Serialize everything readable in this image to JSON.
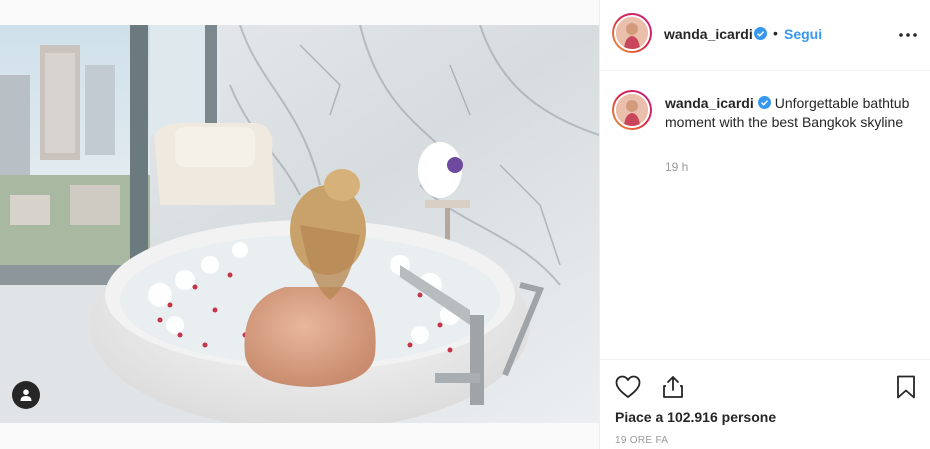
{
  "post": {
    "username": "wanda_icardi",
    "follow_label": "Segui",
    "separator": "•",
    "caption": "Unforgettable bathtub moment with the best Bangkok skyline",
    "comment_time": "19 h",
    "likes_text": "Piace a 102.916 persone",
    "posted_ago": "19 ORE FA"
  },
  "icons": [
    "more-options-icon",
    "verified-badge-icon",
    "heart-icon",
    "share-icon",
    "bookmark-icon",
    "user-tag-icon"
  ],
  "colors": {
    "accent": "#3897f0",
    "text": "#262626",
    "muted": "#999999",
    "border": "#efefef"
  }
}
